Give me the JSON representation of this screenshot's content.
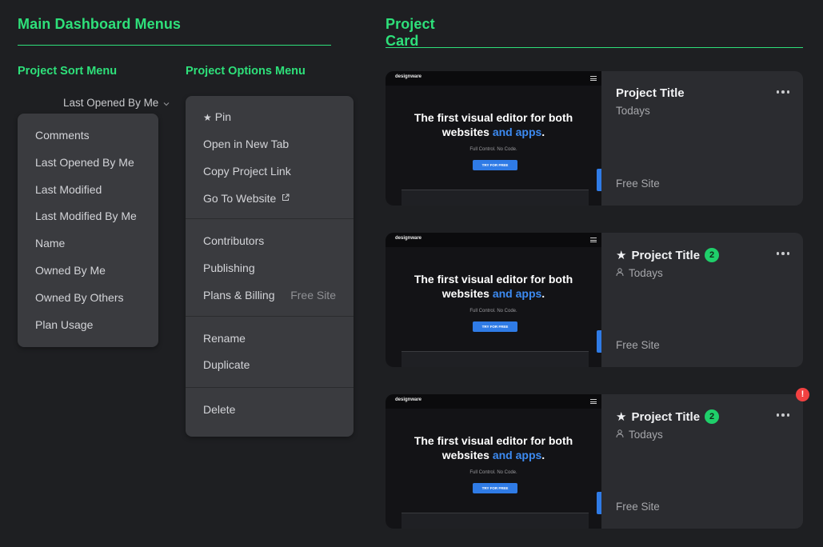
{
  "section_left": {
    "title": "Main Dashboard Menus"
  },
  "section_right": {
    "title_line1": "Project",
    "title_line2": "Card"
  },
  "sort_menu": {
    "heading": "Project Sort Menu",
    "trigger_label": "Last Opened By Me",
    "items": [
      "Comments",
      "Last Opened By Me",
      "Last Modified",
      "Last Modified By Me",
      "Name",
      "Owned By Me",
      "Owned By Others",
      "Plan Usage"
    ]
  },
  "options_menu": {
    "heading": "Project Options Menu",
    "group1": {
      "pin": "Pin",
      "open_new_tab": "Open in New Tab",
      "copy_link": "Copy Project Link",
      "go_to_website": "Go To Website"
    },
    "group2": {
      "contributors": "Contributors",
      "publishing": "Publishing",
      "plans_billing": "Plans & Billing",
      "plans_billing_value": "Free Site"
    },
    "group3": {
      "rename": "Rename",
      "duplicate": "Duplicate"
    },
    "group4": {
      "delete": "Delete"
    }
  },
  "thumbnail": {
    "logo": "designware",
    "headline_line1": "The first visual editor for both",
    "headline_line2_a": "websites ",
    "headline_line2_accent": "and apps",
    "headline_line2_end": ".",
    "subtext": "Full Control. No Code.",
    "cta": "TRY FOR FREE"
  },
  "cards": [
    {
      "title": "Project Title",
      "date": "Todays",
      "plan": "Free Site",
      "starred": false,
      "badge": "",
      "shared": false,
      "alert": false
    },
    {
      "title": "Project Title",
      "date": "Todays",
      "plan": "Free Site",
      "starred": true,
      "badge": "2",
      "shared": true,
      "alert": false
    },
    {
      "title": "Project Title",
      "date": "Todays",
      "plan": "Free Site",
      "starred": true,
      "badge": "2",
      "shared": true,
      "alert": true,
      "alert_symbol": "!"
    }
  ],
  "colors": {
    "accent": "#2ee07a",
    "badge": "#1fcf6a",
    "alert": "#f24141",
    "cta": "#2f7be6"
  }
}
